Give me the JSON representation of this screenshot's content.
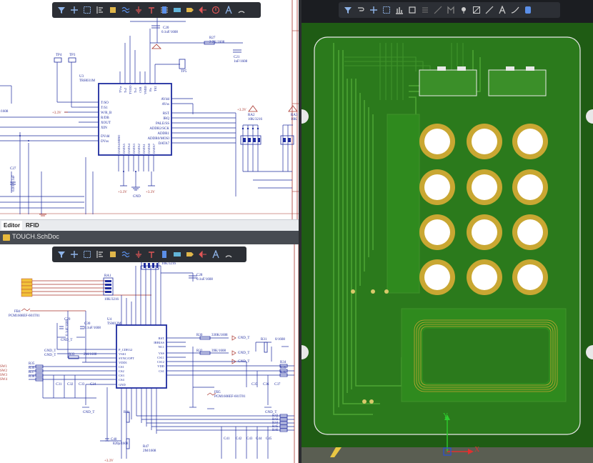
{
  "top_toolbar_icons": [
    "filter-icon",
    "cross-icon",
    "rect-select-icon",
    "align-icon",
    "bus-icon",
    "wire-icon",
    "ground-icon",
    "vcc-icon",
    "component-icon",
    "net-label-icon",
    "port-icon",
    "off-sheet-icon",
    "no-erc-icon",
    "text-icon",
    "arc-icon"
  ],
  "pcb_toolbar_icons": [
    "filter-icon",
    "route-icon",
    "cross-icon",
    "rect-select-icon",
    "align-icon",
    "component-icon",
    "diff-pair-icon",
    "interactive-route-icon",
    "pin-icon",
    "via-icon",
    "line-icon",
    "dimension-icon",
    "text-icon",
    "polygon-icon",
    "keepout-icon"
  ],
  "tabs": {
    "editor": "Editor",
    "rfid": "RFID"
  },
  "doc_title": "TOUCH.SchDoc",
  "schematic_top": {
    "refs": {
      "tp4": "TP4",
      "tp3": "TP3",
      "tp5": "TP5",
      "u3": "U3",
      "u3_part": "TRH031M",
      "c20": "C20",
      "c20_val": "0.1uF/1608",
      "r27": "R27",
      "r27_val": "2.2K/1608",
      "c21": "C21",
      "c21_val": "1nF/1608",
      "ra2": "RA2",
      "ra2_val": "10K/3216",
      "ra3": "RA3",
      "ra3_val": "10K",
      "c27": "C27",
      "c27_val": "0201/0.1uF",
      "left_val": "/1608",
      "vcc_label": "+3.3V",
      "vcc_label2": "+3.3V",
      "gnd_label": "GND",
      "vcc_bottom1": "+3.3V",
      "vcc_bottom2": "+3.3V"
    },
    "u3_pins_left": [
      "T/SO",
      "T/S1",
      "W/R_B",
      "R/DB",
      "XOUT",
      "XIN",
      "DVdd",
      "DVss"
    ],
    "u3_pins_right": [
      "AVdd",
      "AVss",
      "RST",
      "IRQ",
      "PALE/SS",
      "ADDR2/SCK",
      "ADDR1",
      "ADDR0/MOSI",
      "DATA7"
    ],
    "u3_pins_top": [
      "TVss",
      "Tx2",
      "TVDD",
      "Tx1",
      "CSB",
      "VMID",
      "Rx",
      "TS2"
    ],
    "u3_pins_bottom": [
      "DATA6/MISO",
      "DATA5",
      "DATA4",
      "DATA3",
      "DATA2",
      "DATA1",
      "DATA0",
      "DATA7"
    ]
  },
  "schematic_bottom": {
    "refs": {
      "ra4": "RA4",
      "ra4_val": "10K/3216",
      "c28": "C28",
      "c28_val": "0.1uF/1608",
      "ra1": "RA1",
      "ra1_val": "10K/3216",
      "fb4": "FB4",
      "fb4_val": "PCM1608EF-601T01",
      "c29": "C29",
      "c29_val": "0.1uF/1608",
      "c30": "C30",
      "c30_val": "0.1uF/1608",
      "u4": "U4",
      "u4_part": "TSM12M",
      "gnd_t": "GND_T",
      "r33": "R33",
      "r33_val": "2M/1608",
      "r30": "R30",
      "r30_val": "330K/1608",
      "r32": "R32",
      "r32_val": "39K/1608",
      "r31": "R31",
      "r31_val": "0/1608",
      "fb5": "FB5",
      "fb5_val": "PCM1608EF-601T01",
      "c40": "C40",
      "c40_val": "820p/1608",
      "r47": "R47",
      "r47_val": "2M/1608",
      "r41": "R41",
      "vcc_b": "+3.3V"
    },
    "u4_pins_left": [
      "P_CDEG2",
      "VSS1",
      "SYNC/OPT",
      "VDD1",
      "CS1",
      "CS2",
      "CS3",
      "CS4",
      "GND"
    ],
    "u4_pins_right": [
      "RST",
      "IRBIAS",
      "NC1",
      "VSS",
      "CS11",
      "CS12",
      "VDD",
      "CS1"
    ],
    "sw_labels": [
      "SW1",
      "SW2",
      "SW3",
      "SW4"
    ],
    "r_left": [
      "R35",
      "R36",
      "R37",
      "R38"
    ],
    "r_right": [
      "R34",
      "R39",
      "R40"
    ],
    "r_bottom_right": [
      "R42",
      "R43",
      "R44",
      "R45",
      "R46"
    ],
    "c_bottom": [
      "C31",
      "C32",
      "C33",
      "C34",
      "C35",
      "C36",
      "C37"
    ],
    "c_bottom2": [
      "C41",
      "C42",
      "C43",
      "C44",
      "C45"
    ]
  },
  "pcb": {
    "axis_y": "Y",
    "axis_x": "X",
    "colors": {
      "board_dark": "#1f5c14",
      "board_fill": "#2b7a1c",
      "copper": "#3e9a2a",
      "pad_ring": "#c9a732",
      "pad_center": "#ffffff",
      "outline": "#e8e8e8",
      "background": "#1b1d21"
    }
  }
}
